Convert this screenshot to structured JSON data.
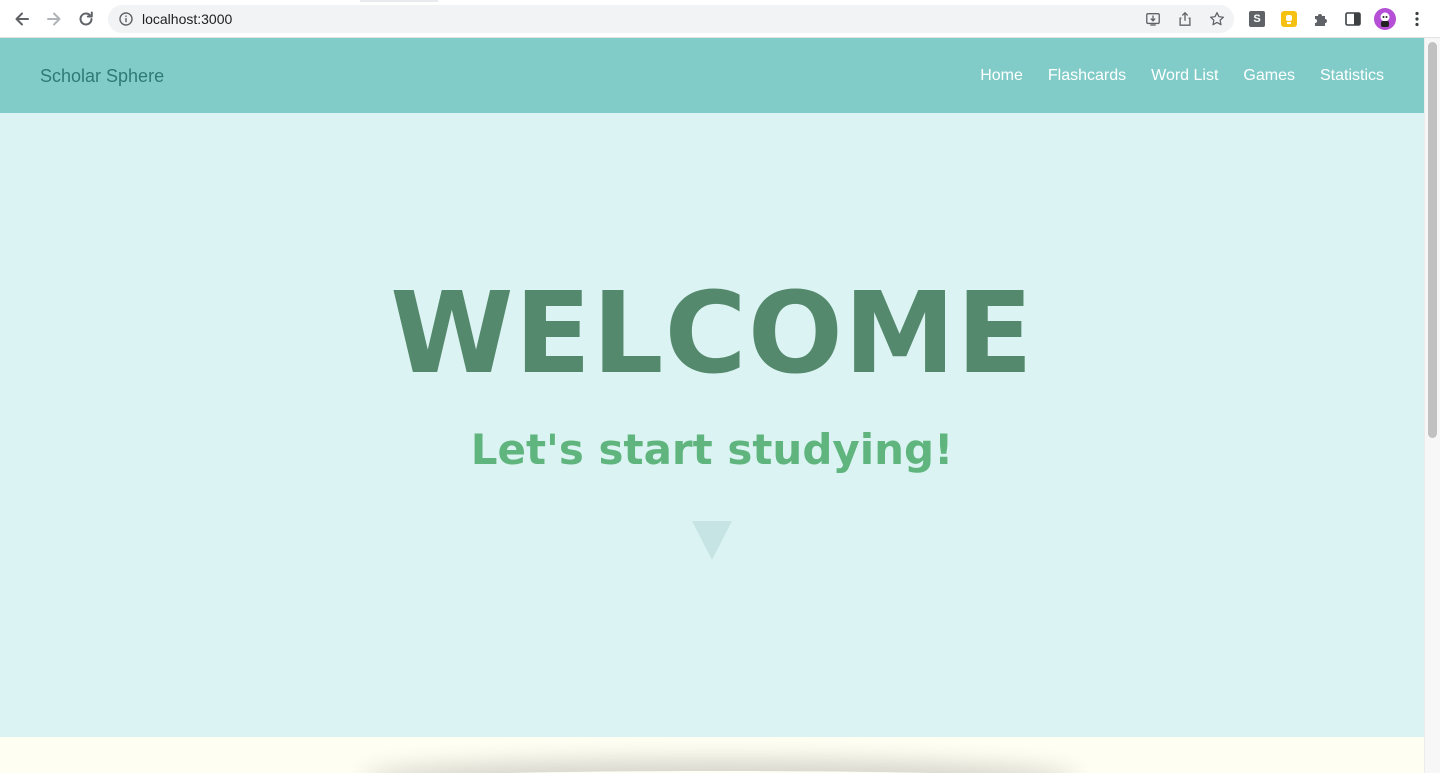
{
  "browser": {
    "url": "localhost:3000",
    "icons": {
      "back": "arrow-left-icon",
      "forward": "arrow-right-icon",
      "reload": "reload-icon",
      "site_info": "info-icon",
      "install": "install-icon",
      "share": "share-icon",
      "bookmark": "star-icon",
      "extensions": "puzzle-icon",
      "side_panel": "side-panel-icon",
      "menu": "kebab-menu-icon"
    },
    "extension_s_letter": "S"
  },
  "site": {
    "brand": "Scholar Sphere",
    "nav": [
      {
        "label": "Home"
      },
      {
        "label": "Flashcards"
      },
      {
        "label": "Word List"
      },
      {
        "label": "Games"
      },
      {
        "label": "Statistics"
      }
    ]
  },
  "hero": {
    "title": "WELCOME",
    "subtitle": "Let's start studying!"
  },
  "colors": {
    "header_bg": "#81ccc8",
    "hero_bg": "#dbf4f3",
    "title": "#55896d",
    "subtitle": "#5fb57d",
    "brand": "#2f7a74",
    "section_bg": "#fefef3"
  }
}
